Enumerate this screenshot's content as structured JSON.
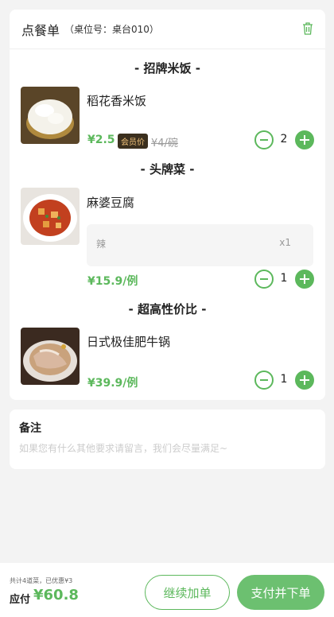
{
  "header": {
    "title": "点餐单",
    "table_info": "（桌位号：桌台010）"
  },
  "categories": [
    {
      "name": "- 招牌米饭 -"
    },
    {
      "name": "- 头牌菜 -"
    },
    {
      "name": "- 超高性价比 -"
    }
  ],
  "dishes": [
    {
      "name": "稻花香米饭",
      "price": "¥2.5",
      "member_badge": "会员价",
      "original_price": "¥4/碗",
      "quantity": "2"
    },
    {
      "name": "麻婆豆腐",
      "spec": "辣",
      "spec_count": "x1",
      "price": "¥15.9/例",
      "quantity": "1"
    },
    {
      "name": "日式极佳肥牛锅",
      "price": "¥39.9/例",
      "quantity": "1"
    }
  ],
  "note": {
    "title": "备注",
    "placeholder": "如果您有什么其他要求请留言，我们会尽量满足~"
  },
  "footer": {
    "summary": "共计4道菜，已优惠¥3",
    "total_label": "应付",
    "total_amount": "¥60.8",
    "continue_label": "继续加单",
    "pay_label": "支付并下单"
  },
  "colors": {
    "accent": "#5cb85c",
    "badge_bg": "#3b2f1e",
    "badge_text": "#f0c27b"
  }
}
